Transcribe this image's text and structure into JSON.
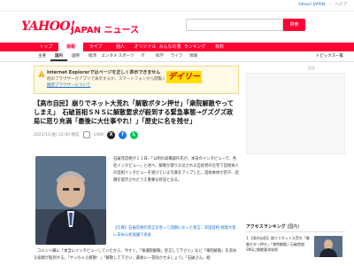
{
  "utility": {
    "links": [
      "Yahoo! JAPAN",
      "ヘルプ"
    ]
  },
  "brand": {
    "logo": "YAHOO!",
    "section": "JAPAN ニュース",
    "search_button": "検索"
  },
  "primary_nav": [
    {
      "label": "トップ",
      "active": false
    },
    {
      "label": "速報",
      "active": true
    },
    {
      "label": "ライブ",
      "active": false
    },
    {
      "label": "個人",
      "active": false
    },
    {
      "label": "オリジナル",
      "active": false
    },
    {
      "label": "みんなの意見",
      "active": false
    },
    {
      "label": "ランキング",
      "active": false
    },
    {
      "label": "有料",
      "active": false
    }
  ],
  "secondary_nav": [
    {
      "label": "主要",
      "active": false
    },
    {
      "label": "国内",
      "active": true
    },
    {
      "label": "国際",
      "active": false
    },
    {
      "label": "経済",
      "active": false
    },
    {
      "label": "エンタメ",
      "active": false
    },
    {
      "label": "スポーツ",
      "active": false
    },
    {
      "label": "IT",
      "active": false
    },
    {
      "label": "科学",
      "active": false
    },
    {
      "label": "ライフ",
      "active": false
    },
    {
      "label": "地域",
      "active": false
    }
  ],
  "sidebar_top_link": "トピックス一覧",
  "ie_notice": {
    "title": "Internet Explorerではページを正しく表示できません",
    "body": "他のブラウザーかアプリで表示するか、スマートフォンから閲覧ください。",
    "link": "推奨ブラウザーについて"
  },
  "article": {
    "headline": "【高市自民】崩りでネット大荒れ「解散ボタン押せ」「衆院解散やってしまえ」　石破首相ＳＮＳに解散要求が殺到する緊急事態→グズグズ政局に怒り充満「最後に大仕事やれ！」「歴史に名を残せ」",
    "date": "2021/11(金) 22:00 配信",
    "comments": "1400",
    "source_logo": "デイリー",
    "body": "石破茂首相が１１日、「公明の高橋誠作氏が、本日のインタビューで、各社インタビュー」と述べ、解散が取り沙汰される自民党の在宅で首相本人の首相インタビューを受けている写真をアップした。首相本体が若干、話題を提示されたうえ重要な状況となる。",
    "caption": "【写真】石破首相の発言を巡って話題になった発言、岸田首相 総理大臣に日米公式協議で再会",
    "para2": "コメント欄に「本当にインタビューしていたから、今すぐ。「衆議院解散」宣言して下さい」など「衆院解散」を求める投稿が殺到する。「やっちゃえ解散！」「解散して下さい、最後に一花咲かせましょう」「石破さん、総"
  },
  "sidebar": {
    "ad_label": "広告",
    "ranking_title": "アクセスランキング",
    "ranking_tab": "(国内)",
    "ranking_item": "1 【高市自民】崩りでネット大荒れ「解散ボタン押せ」「衆院解散」石破首相SNSに解散要求殺到"
  }
}
